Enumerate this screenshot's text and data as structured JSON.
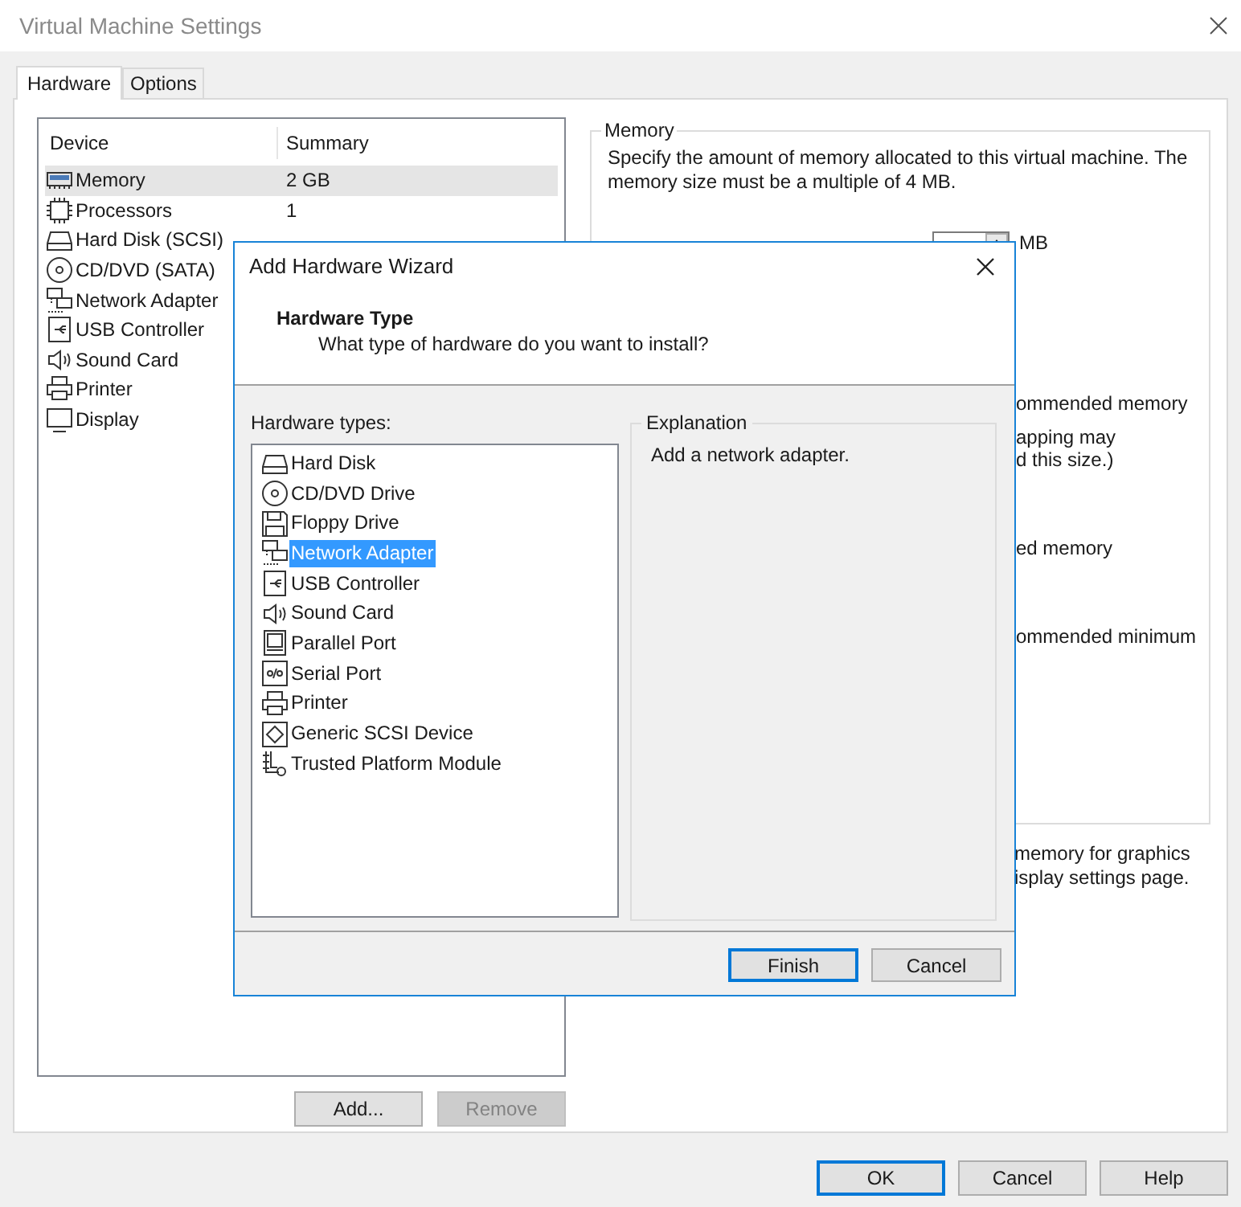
{
  "window": {
    "title": "Virtual Machine Settings"
  },
  "tabs": [
    {
      "label": "Hardware",
      "selected": true
    },
    {
      "label": "Options",
      "selected": false
    }
  ],
  "device_list": {
    "columns": [
      "Device",
      "Summary"
    ],
    "rows": [
      {
        "kind": "memory",
        "device": "Memory",
        "summary": "2 GB",
        "selected": true
      },
      {
        "kind": "cpu",
        "device": "Processors",
        "summary": "1",
        "selected": false
      },
      {
        "kind": "disk",
        "device": "Hard Disk (SCSI)",
        "selected": false
      },
      {
        "kind": "cd",
        "device": "CD/DVD (SATA)",
        "selected": false
      },
      {
        "kind": "network",
        "device": "Network Adapter",
        "selected": false
      },
      {
        "kind": "usb",
        "device": "USB Controller",
        "selected": false
      },
      {
        "kind": "sound",
        "device": "Sound Card",
        "selected": false
      },
      {
        "kind": "printer",
        "device": "Printer",
        "selected": false
      },
      {
        "kind": "display",
        "device": "Display",
        "selected": false
      }
    ]
  },
  "device_buttons": [
    {
      "label": "Add...",
      "disabled": false
    },
    {
      "label": "Remove",
      "disabled": true
    }
  ],
  "memory_panel": {
    "title": "Memory",
    "description": "Specify the amount of memory allocated to this virtual machine. The memory size must be a multiple of 4 MB.",
    "unit": "MB",
    "fragments": [
      [
        "ommended memory"
      ],
      [
        "apping may",
        "d this size.)"
      ],
      [
        "ed memory"
      ],
      [
        "ommended minimum"
      ]
    ],
    "note": [
      "memory for graphics",
      "isplay settings page."
    ]
  },
  "dialog": {
    "title": "Add Hardware Wizard",
    "heading": "Hardware Type",
    "subheading": "What type of hardware do you want to install?",
    "list_label": "Hardware types:",
    "types": [
      {
        "kind": "disk",
        "label": "Hard Disk",
        "selected": false
      },
      {
        "kind": "cd",
        "label": "CD/DVD Drive",
        "selected": false
      },
      {
        "kind": "floppy",
        "label": "Floppy Drive",
        "selected": false
      },
      {
        "kind": "network",
        "label": "Network Adapter",
        "selected": true
      },
      {
        "kind": "usb",
        "label": "USB Controller",
        "selected": false
      },
      {
        "kind": "sound",
        "label": "Sound Card",
        "selected": false
      },
      {
        "kind": "parallel",
        "label": "Parallel Port",
        "selected": false
      },
      {
        "kind": "serial",
        "label": "Serial Port",
        "selected": false
      },
      {
        "kind": "printer",
        "label": "Printer",
        "selected": false
      },
      {
        "kind": "scsi",
        "label": "Generic SCSI Device",
        "selected": false
      },
      {
        "kind": "tpm",
        "label": "Trusted Platform Module",
        "selected": false
      }
    ],
    "explanation": {
      "title": "Explanation",
      "text": "Add a network adapter."
    },
    "buttons": [
      {
        "label": "Finish",
        "default": true
      },
      {
        "label": "Cancel",
        "default": false
      }
    ]
  },
  "buttons": [
    {
      "label": "OK",
      "default": true
    },
    {
      "label": "Cancel",
      "default": false
    },
    {
      "label": "Help",
      "default": false
    }
  ]
}
